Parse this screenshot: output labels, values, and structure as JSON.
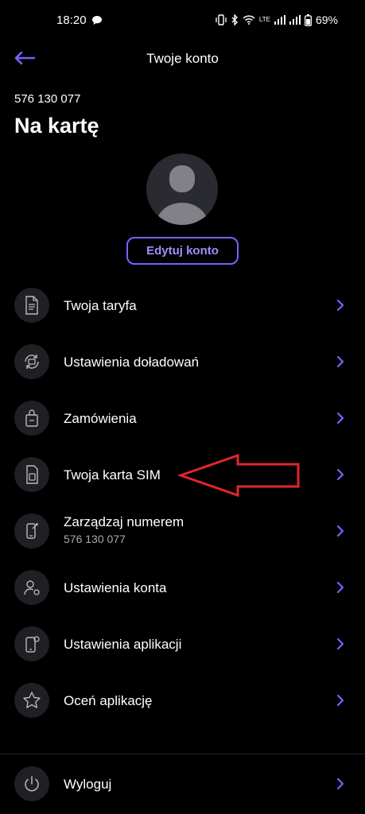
{
  "status_bar": {
    "time": "18:20",
    "network": "LTE",
    "battery": "69%"
  },
  "header": {
    "title": "Twoje konto",
    "accent_color": "#7b61ff"
  },
  "account": {
    "phone_number": "576 130 077",
    "plan_name": "Na kartę",
    "edit_label": "Edytuj konto"
  },
  "menu": {
    "items": [
      {
        "label": "Twoja taryfa",
        "icon": "document-icon"
      },
      {
        "label": "Ustawienia doładowań",
        "icon": "topup-refresh-icon"
      },
      {
        "label": "Zamówienia",
        "icon": "order-bag-icon"
      },
      {
        "label": "Twoja karta SIM",
        "icon": "sim-card-icon"
      },
      {
        "label": "Zarządzaj numerem",
        "sublabel": "576 130 077",
        "icon": "phone-tools-icon"
      },
      {
        "label": "Ustawienia konta",
        "icon": "user-settings-icon"
      },
      {
        "label": "Ustawienia aplikacji",
        "icon": "app-settings-icon"
      },
      {
        "label": "Oceń aplikację",
        "icon": "star-icon"
      }
    ],
    "logout_label": "Wyloguj"
  },
  "colors": {
    "background": "#000000",
    "accent": "#7b61ff",
    "icon_circle": "#1f1f24",
    "annotation": "#e0262b"
  }
}
